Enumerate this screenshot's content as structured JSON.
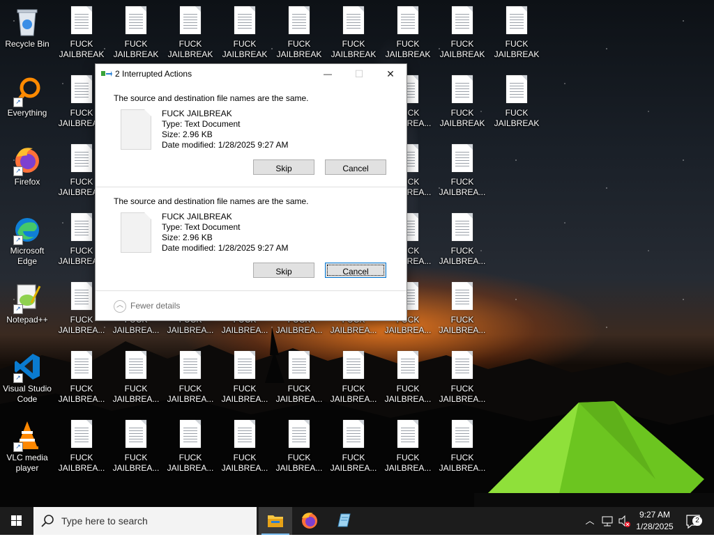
{
  "desktop_icons": {
    "recycle_bin": "Recycle Bin",
    "everything": "Everything",
    "firefox": "Firefox",
    "edge": "Microsoft\nEdge",
    "notepadpp": "Notepad++",
    "vscode": "Visual Studio\nCode",
    "vlc": "VLC media\nplayer",
    "file_full": "FUCK\nJAILBREAK",
    "file_short": "FUCK\nJAILBREA..."
  },
  "dialog": {
    "title": "2 Interrupted Actions",
    "minimize": "—",
    "maximize": "☐",
    "close": "✕",
    "conflicts": [
      {
        "message": "The source and destination file names are the same.",
        "name": "FUCK JAILBREAK",
        "type": "Type: Text Document",
        "size": "Size: 2.96 KB",
        "modified": "Date modified: 1/28/2025 9:27 AM",
        "skip": "Skip",
        "cancel": "Cancel"
      },
      {
        "message": "The source and destination file names are the same.",
        "name": "FUCK JAILBREAK",
        "type": "Type: Text Document",
        "size": "Size: 2.96 KB",
        "modified": "Date modified: 1/28/2025 9:27 AM",
        "skip": "Skip",
        "cancel": "Cancel"
      }
    ],
    "fewer_details": "Fewer details"
  },
  "taskbar": {
    "search_placeholder": "Type here to search",
    "time": "9:27 AM",
    "date": "1/28/2025",
    "notification_count": "2"
  },
  "colors": {
    "taskbar_bg": "#1c1c1c",
    "accent": "#0078d7",
    "tent_green": "#7ad125"
  }
}
